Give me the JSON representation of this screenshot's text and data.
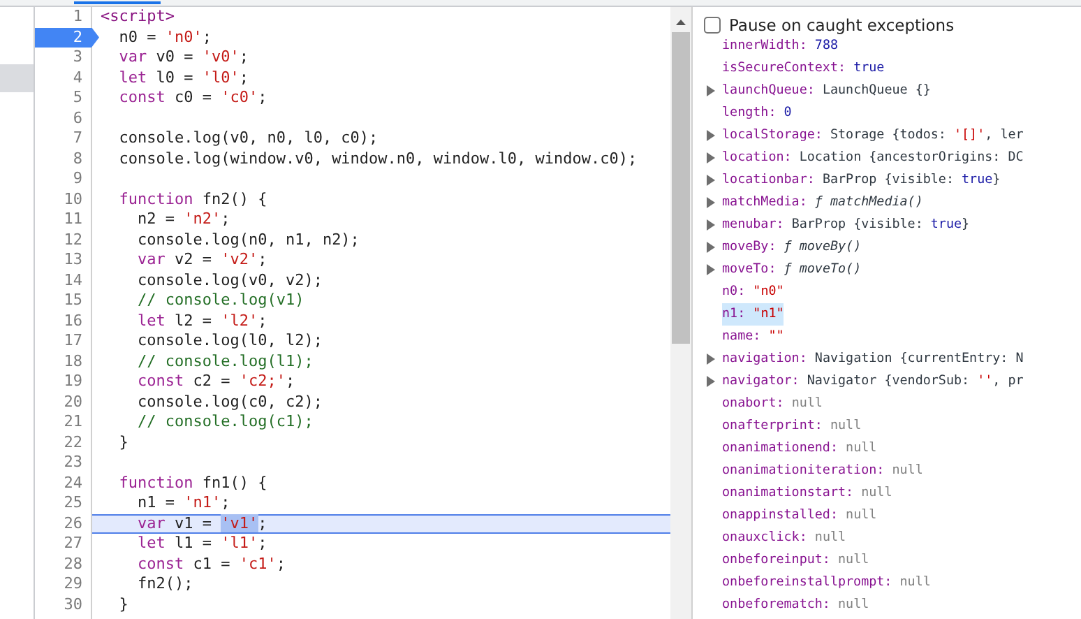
{
  "code_lines": [
    {
      "number": "1",
      "breakpoint": false,
      "current": false,
      "tokens": [
        {
          "kind": "tag",
          "text": "<script>"
        }
      ]
    },
    {
      "number": "2",
      "breakpoint": true,
      "current": false,
      "tokens": [
        {
          "kind": "plain",
          "text": "  n0 = "
        },
        {
          "kind": "string",
          "text": "'n0'"
        },
        {
          "kind": "plain",
          "text": ";"
        }
      ]
    },
    {
      "number": "3",
      "breakpoint": false,
      "current": false,
      "tokens": [
        {
          "kind": "keyword",
          "text": "  var"
        },
        {
          "kind": "plain",
          "text": " v0 = "
        },
        {
          "kind": "string",
          "text": "'v0'"
        },
        {
          "kind": "plain",
          "text": ";"
        }
      ]
    },
    {
      "number": "4",
      "breakpoint": false,
      "current": false,
      "tokens": [
        {
          "kind": "keyword",
          "text": "  let"
        },
        {
          "kind": "plain",
          "text": " l0 = "
        },
        {
          "kind": "string",
          "text": "'l0'"
        },
        {
          "kind": "plain",
          "text": ";"
        }
      ]
    },
    {
      "number": "5",
      "breakpoint": false,
      "current": false,
      "tokens": [
        {
          "kind": "keyword",
          "text": "  const"
        },
        {
          "kind": "plain",
          "text": " c0 = "
        },
        {
          "kind": "string",
          "text": "'c0'"
        },
        {
          "kind": "plain",
          "text": ";"
        }
      ]
    },
    {
      "number": "6",
      "breakpoint": false,
      "current": false
    },
    {
      "number": "7",
      "breakpoint": false,
      "current": false,
      "tokens": [
        {
          "kind": "plain",
          "text": "  console.log(v0, n0, l0, c0);"
        }
      ]
    },
    {
      "number": "8",
      "breakpoint": false,
      "current": false,
      "tokens": [
        {
          "kind": "plain",
          "text": "  console.log(window.v0, window.n0, window.l0, window.c0);"
        }
      ]
    },
    {
      "number": "9",
      "breakpoint": false,
      "current": false
    },
    {
      "number": "10",
      "breakpoint": false,
      "current": false,
      "tokens": [
        {
          "kind": "keyword",
          "text": "  function"
        },
        {
          "kind": "plain",
          "text": " fn2() {"
        }
      ]
    },
    {
      "number": "11",
      "breakpoint": false,
      "current": false,
      "tokens": [
        {
          "kind": "plain",
          "text": "    n2 = "
        },
        {
          "kind": "string",
          "text": "'n2'"
        },
        {
          "kind": "plain",
          "text": ";"
        }
      ]
    },
    {
      "number": "12",
      "breakpoint": false,
      "current": false,
      "tokens": [
        {
          "kind": "plain",
          "text": "    console.log(n0, n1, n2);"
        }
      ]
    },
    {
      "number": "13",
      "breakpoint": false,
      "current": false,
      "tokens": [
        {
          "kind": "keyword",
          "text": "    var"
        },
        {
          "kind": "plain",
          "text": " v2 = "
        },
        {
          "kind": "string",
          "text": "'v2'"
        },
        {
          "kind": "plain",
          "text": ";"
        }
      ]
    },
    {
      "number": "14",
      "breakpoint": false,
      "current": false,
      "tokens": [
        {
          "kind": "plain",
          "text": "    console.log(v0, v2);"
        }
      ]
    },
    {
      "number": "15",
      "breakpoint": false,
      "current": false,
      "tokens": [
        {
          "kind": "comment",
          "text": "    // console.log(v1)"
        }
      ]
    },
    {
      "number": "16",
      "breakpoint": false,
      "current": false,
      "tokens": [
        {
          "kind": "keyword",
          "text": "    let"
        },
        {
          "kind": "plain",
          "text": " l2 = "
        },
        {
          "kind": "string",
          "text": "'l2'"
        },
        {
          "kind": "plain",
          "text": ";"
        }
      ]
    },
    {
      "number": "17",
      "breakpoint": false,
      "current": false,
      "tokens": [
        {
          "kind": "plain",
          "text": "    console.log(l0, l2);"
        }
      ]
    },
    {
      "number": "18",
      "breakpoint": false,
      "current": false,
      "tokens": [
        {
          "kind": "comment",
          "text": "    // console.log(l1);"
        }
      ]
    },
    {
      "number": "19",
      "breakpoint": false,
      "current": false,
      "tokens": [
        {
          "kind": "keyword",
          "text": "    const"
        },
        {
          "kind": "plain",
          "text": " c2 = "
        },
        {
          "kind": "string",
          "text": "'c2;'"
        },
        {
          "kind": "plain",
          "text": ";"
        }
      ]
    },
    {
      "number": "20",
      "breakpoint": false,
      "current": false,
      "tokens": [
        {
          "kind": "plain",
          "text": "    console.log(c0, c2);"
        }
      ]
    },
    {
      "number": "21",
      "breakpoint": false,
      "current": false,
      "tokens": [
        {
          "kind": "comment",
          "text": "    // console.log(c1);"
        }
      ]
    },
    {
      "number": "22",
      "breakpoint": false,
      "current": false,
      "tokens": [
        {
          "kind": "plain",
          "text": "  }"
        }
      ]
    },
    {
      "number": "23",
      "breakpoint": false,
      "current": false
    },
    {
      "number": "24",
      "breakpoint": false,
      "current": false,
      "tokens": [
        {
          "kind": "keyword",
          "text": "  function"
        },
        {
          "kind": "plain",
          "text": " fn1() {"
        }
      ]
    },
    {
      "number": "25",
      "breakpoint": false,
      "current": false,
      "tokens": [
        {
          "kind": "plain",
          "text": "    n1 = "
        },
        {
          "kind": "string",
          "text": "'n1'"
        },
        {
          "kind": "plain",
          "text": ";"
        }
      ]
    },
    {
      "number": "26",
      "breakpoint": false,
      "current": true,
      "tokens": [
        {
          "kind": "keyword",
          "text": "    var"
        },
        {
          "kind": "plain",
          "text": " v1 = "
        },
        {
          "kind": "string",
          "text": "'v1'",
          "selected": true
        },
        {
          "kind": "plain",
          "text": ";"
        }
      ]
    },
    {
      "number": "27",
      "breakpoint": false,
      "current": false,
      "tokens": [
        {
          "kind": "keyword",
          "text": "    let"
        },
        {
          "kind": "plain",
          "text": " l1 = "
        },
        {
          "kind": "string",
          "text": "'l1'"
        },
        {
          "kind": "plain",
          "text": ";"
        }
      ]
    },
    {
      "number": "28",
      "breakpoint": false,
      "current": false,
      "tokens": [
        {
          "kind": "keyword",
          "text": "    const"
        },
        {
          "kind": "plain",
          "text": " c1 = "
        },
        {
          "kind": "string",
          "text": "'c1'"
        },
        {
          "kind": "plain",
          "text": ";"
        }
      ]
    },
    {
      "number": "29",
      "breakpoint": false,
      "current": false,
      "tokens": [
        {
          "kind": "plain",
          "text": "    fn2();"
        }
      ]
    },
    {
      "number": "30",
      "breakpoint": false,
      "current": false,
      "tokens": [
        {
          "kind": "plain",
          "text": "  }"
        }
      ]
    }
  ],
  "pause_on_caught_exceptions": {
    "label": "Pause on caught exceptions",
    "checked": false
  },
  "scope_properties": [
    {
      "name": "innerWidth:",
      "expandable": false,
      "selected": false,
      "value": [
        {
          "kind": "number",
          "text": "788"
        }
      ]
    },
    {
      "name": "isSecureContext:",
      "expandable": false,
      "selected": false,
      "value": [
        {
          "kind": "number",
          "text": "true"
        }
      ]
    },
    {
      "name": "launchQueue:",
      "expandable": true,
      "selected": false,
      "value": [
        {
          "kind": "object",
          "text": "LaunchQueue {}"
        }
      ]
    },
    {
      "name": "length:",
      "expandable": false,
      "selected": false,
      "value": [
        {
          "kind": "number",
          "text": "0"
        }
      ]
    },
    {
      "name": "localStorage:",
      "expandable": true,
      "selected": false,
      "value": [
        {
          "kind": "object",
          "text": "Storage {todos: "
        },
        {
          "kind": "string",
          "text": "'[]'"
        },
        {
          "kind": "object",
          "text": ", ler"
        }
      ]
    },
    {
      "name": "location:",
      "expandable": true,
      "selected": false,
      "value": [
        {
          "kind": "object",
          "text": "Location {ancestorOrigins: DC"
        }
      ]
    },
    {
      "name": "locationbar:",
      "expandable": true,
      "selected": false,
      "value": [
        {
          "kind": "object",
          "text": "BarProp {visible: "
        },
        {
          "kind": "number",
          "text": "true"
        },
        {
          "kind": "object",
          "text": "}"
        }
      ]
    },
    {
      "name": "matchMedia:",
      "expandable": true,
      "selected": false,
      "value": [
        {
          "kind": "function",
          "text": "ƒ matchMedia()"
        }
      ]
    },
    {
      "name": "menubar:",
      "expandable": true,
      "selected": false,
      "value": [
        {
          "kind": "object",
          "text": "BarProp {visible: "
        },
        {
          "kind": "number",
          "text": "true"
        },
        {
          "kind": "object",
          "text": "}"
        }
      ]
    },
    {
      "name": "moveBy:",
      "expandable": true,
      "selected": false,
      "value": [
        {
          "kind": "function",
          "text": "ƒ moveBy()"
        }
      ]
    },
    {
      "name": "moveTo:",
      "expandable": true,
      "selected": false,
      "value": [
        {
          "kind": "function",
          "text": "ƒ moveTo()"
        }
      ]
    },
    {
      "name": "n0:",
      "expandable": false,
      "selected": false,
      "value": [
        {
          "kind": "string",
          "text": "\"n0\""
        }
      ]
    },
    {
      "name": "n1:",
      "expandable": false,
      "selected": true,
      "value": [
        {
          "kind": "string",
          "text": "\"n1\""
        }
      ]
    },
    {
      "name": "name:",
      "expandable": false,
      "selected": false,
      "value": [
        {
          "kind": "string",
          "text": "\"\""
        }
      ]
    },
    {
      "name": "navigation:",
      "expandable": true,
      "selected": false,
      "value": [
        {
          "kind": "object",
          "text": "Navigation {currentEntry: N"
        }
      ]
    },
    {
      "name": "navigator:",
      "expandable": true,
      "selected": false,
      "value": [
        {
          "kind": "object",
          "text": "Navigator {vendorSub: "
        },
        {
          "kind": "string",
          "text": "''"
        },
        {
          "kind": "object",
          "text": ", pr"
        }
      ]
    },
    {
      "name": "onabort:",
      "expandable": false,
      "selected": false,
      "value": [
        {
          "kind": "null",
          "text": "null"
        }
      ]
    },
    {
      "name": "onafterprint:",
      "expandable": false,
      "selected": false,
      "value": [
        {
          "kind": "null",
          "text": "null"
        }
      ]
    },
    {
      "name": "onanimationend:",
      "expandable": false,
      "selected": false,
      "value": [
        {
          "kind": "null",
          "text": "null"
        }
      ]
    },
    {
      "name": "onanimationiteration:",
      "expandable": false,
      "selected": false,
      "value": [
        {
          "kind": "null",
          "text": "null"
        }
      ]
    },
    {
      "name": "onanimationstart:",
      "expandable": false,
      "selected": false,
      "value": [
        {
          "kind": "null",
          "text": "null"
        }
      ]
    },
    {
      "name": "onappinstalled:",
      "expandable": false,
      "selected": false,
      "value": [
        {
          "kind": "null",
          "text": "null"
        }
      ]
    },
    {
      "name": "onauxclick:",
      "expandable": false,
      "selected": false,
      "value": [
        {
          "kind": "null",
          "text": "null"
        }
      ]
    },
    {
      "name": "onbeforeinput:",
      "expandable": false,
      "selected": false,
      "value": [
        {
          "kind": "null",
          "text": "null"
        }
      ]
    },
    {
      "name": "onbeforeinstallprompt:",
      "expandable": false,
      "selected": false,
      "value": [
        {
          "kind": "null",
          "text": "null"
        }
      ]
    },
    {
      "name": "onbeforematch:",
      "expandable": false,
      "selected": false,
      "value": [
        {
          "kind": "null",
          "text": "null"
        }
      ]
    }
  ]
}
